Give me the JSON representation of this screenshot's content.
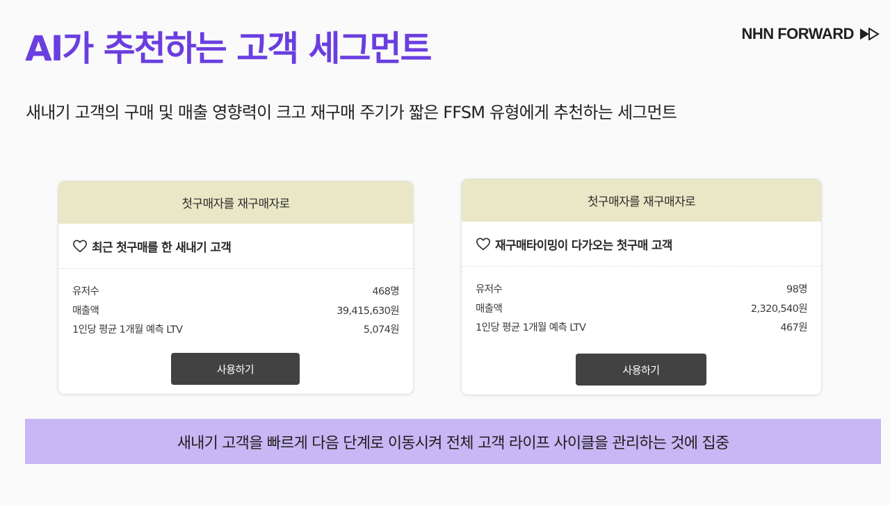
{
  "page": {
    "title": "AI가 추천하는 고객 세그먼트",
    "subtitle": "새내기 고객의 구매 및 매출 영향력이 크고 재구매 주기가 짧은 FFSM 유형에게 추천하는 세그먼트",
    "banner": "새내기 고객을 빠르게 다음 단계로 이동시켜 전체 고객 라이프 사이클을 관리하는 것에 집중"
  },
  "brand": {
    "name": "NHN FORWARD",
    "icon": "double-play-arrow-icon"
  },
  "cards": [
    {
      "header": "첫구매자를 재구매자로",
      "segment_icon": "heart-outline-icon",
      "segment_title": "최근 첫구매를 한 새내기 고객",
      "stats": [
        {
          "label": "유저수",
          "value": "468명"
        },
        {
          "label": "매출액",
          "value": "39,415,630원"
        },
        {
          "label": "1인당 평균 1개월 예측 LTV",
          "value": "5,074원"
        }
      ],
      "button_label": "사용하기"
    },
    {
      "header": "첫구매자를 재구매자로",
      "segment_icon": "heart-outline-icon",
      "segment_title": "재구매타이밍이 다가오는 첫구매 고객",
      "stats": [
        {
          "label": "유저수",
          "value": "98명"
        },
        {
          "label": "매출액",
          "value": "2,320,540원"
        },
        {
          "label": "1인당 평균 1개월 예측 LTV",
          "value": "467원"
        }
      ],
      "button_label": "사용하기"
    }
  ],
  "colors": {
    "title": "#6a3ee0",
    "card_header_bg": "#e9e7c6",
    "button_bg": "#424242",
    "banner_bg": "#c8b6f5"
  }
}
